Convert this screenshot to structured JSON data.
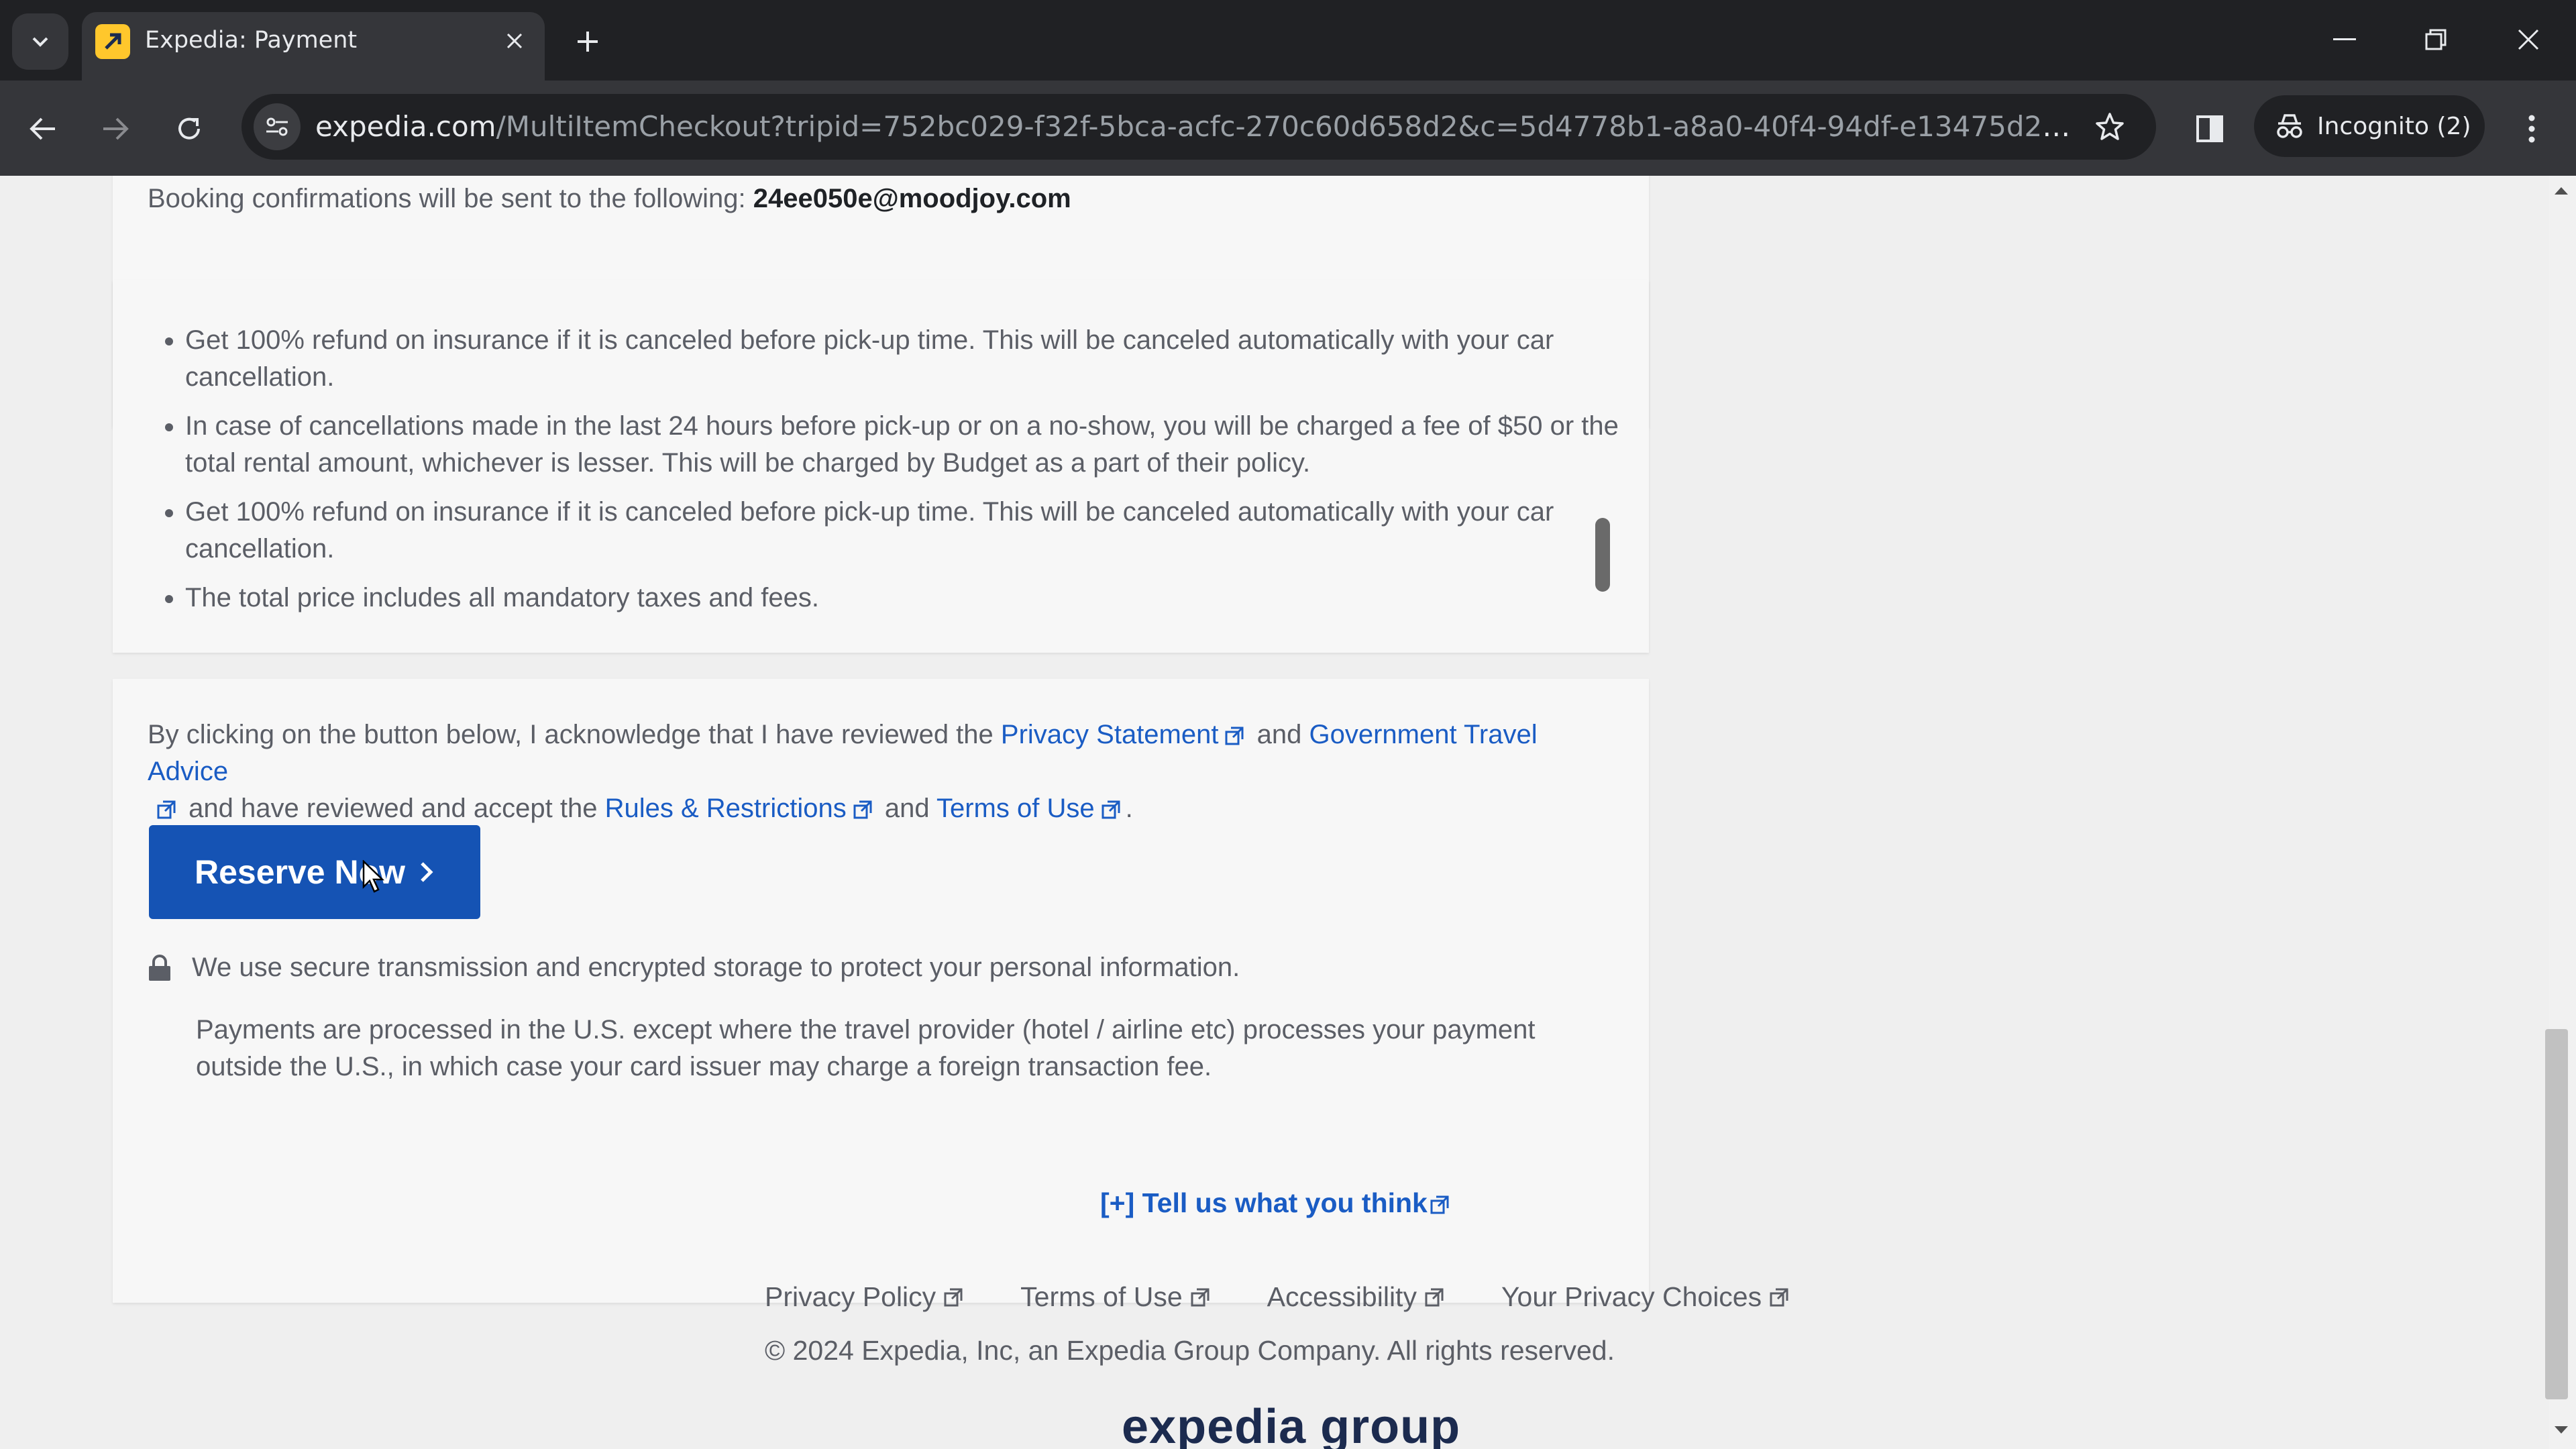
{
  "browser": {
    "tab_title": "Expedia: Payment",
    "url_host": "expedia.com",
    "url_path": "/MultiItemCheckout?tripid=752bc029-f32f-5bca-acfc-270c60d658d2&c=5d4778b1-a8a0-40f4-94df-e13475d26b07&swpApplie...",
    "incognito_label": "Incognito (2)"
  },
  "confirmation": {
    "label": "Booking confirmations will be sent to the following:",
    "email": "24ee050e@moodjoy.com"
  },
  "policy_bullets": [
    "Get 100% refund on insurance if it is canceled before pick-up time. This will be canceled automatically with your car cancellation.",
    "In case of cancellations made in the last 24 hours before pick-up or on a no-show, you will be charged a fee of $50 or the total rental amount, whichever is lesser. This will be charged by Budget as a part of their policy.",
    "Get 100% refund on insurance if it is canceled before pick-up time. This will be canceled automatically with your car cancellation.",
    "The total price includes all mandatory taxes and fees."
  ],
  "legal": {
    "prefix": "By clicking on the button below, I acknowledge that I have reviewed the",
    "privacy_statement": "Privacy Statement",
    "and1": "and",
    "gov_travel_advice": "Government Travel Advice",
    "middle": "and have reviewed and accept the",
    "rules": "Rules & Restrictions",
    "and2": "and",
    "terms": "Terms of Use",
    "end": "."
  },
  "reserve_button": "Reserve Now",
  "secure_text": "We use secure transmission and encrypted storage to protect your personal information.",
  "payments_text": "Payments are processed in the U.S. except where the travel provider (hotel / airline etc) processes your payment outside the U.S., in which case your card issuer may charge a foreign transaction fee.",
  "feedback_link": "[+] Tell us what you think",
  "footer": {
    "links": [
      "Privacy Policy",
      "Terms of Use",
      "Accessibility",
      "Your Privacy Choices"
    ],
    "copyright": "© 2024 Expedia, Inc, an Expedia Group Company. All rights reserved.",
    "logo": "expedia group"
  },
  "colors": {
    "primary_button": "#1553b4",
    "link": "#1a5cc4",
    "brand_favicon": "#ffc72c"
  }
}
